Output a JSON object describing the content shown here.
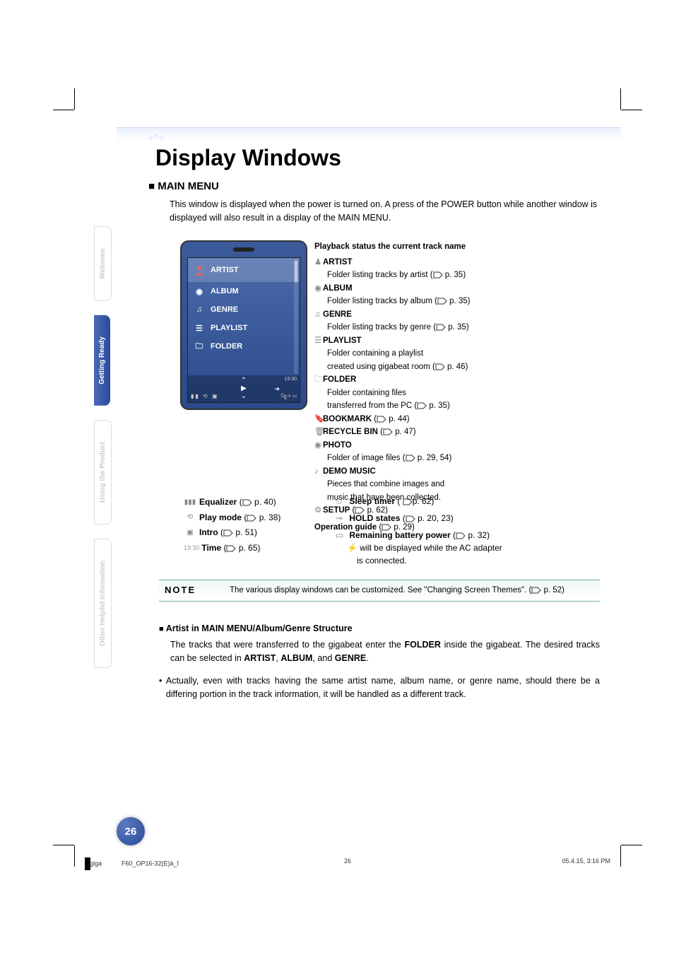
{
  "side_tabs": {
    "welcome": "Welcome",
    "ready": "Getting Ready",
    "using": "Using the Product",
    "other": "Other Helpful Information"
  },
  "title": "Display Windows",
  "section_heading": "MAIN MENU",
  "intro": "This window is displayed when the power is turned on. A press of the POWER button while another window is displayed will also result in a display of the MAIN MENU.",
  "device_menu": {
    "artist": "ARTIST",
    "artist_count": "5",
    "album": "ALBUM",
    "genre": "GENRE",
    "playlist": "PLAYLIST",
    "folder": "FOLDER",
    "time_small": "19:30"
  },
  "annotations": {
    "lead": "Playback status    the current track name",
    "artist_h": "ARTIST",
    "artist_d": "Folder listing tracks by artist (",
    "artist_p": "p. 35)",
    "album_h": "ALBUM",
    "album_d": "Folder listing tracks by album (",
    "album_p": "p. 35)",
    "genre_h": "GENRE",
    "genre_d": "Folder listing tracks by genre (",
    "genre_p": "p. 35)",
    "playlist_h": "PLAYLIST",
    "playlist_d1": "Folder containing a playlist",
    "playlist_d2": "created using gigabeat room (",
    "playlist_p": "p. 46)",
    "folder_h": "FOLDER",
    "folder_d1": "Folder containing files",
    "folder_d2": "transferred from the PC (",
    "folder_p": "p. 35)",
    "bookmark_h": "BOOKMARK",
    "bookmark_p": "p. 44)",
    "recycle_h": "RECYCLE BIN",
    "recycle_p": "p. 47)",
    "photo_h": "PHOTO",
    "photo_d": "Folder of image files (",
    "photo_p": "p. 29, 54)",
    "demo_h": "DEMO MUSIC",
    "demo_d1": "Pieces that combine images and",
    "demo_d2": "music that have been collected.",
    "setup_h": "SETUP",
    "setup_p": "p. 62)",
    "opguide": "Operation guide",
    "opguide_p": "p. 29)"
  },
  "lower_left": {
    "eq_label": "Equalizer",
    "eq_p": "p. 40)",
    "pm_label": "Play mode",
    "pm_p": "p. 38)",
    "intro_label": "Intro",
    "intro_p": "p. 51)",
    "time_label": "Time",
    "time_p": "p. 65)",
    "time_sample": "19:30"
  },
  "lower_right": {
    "sleep_label": "Sleep timer",
    "sleep_p": "p. 62)",
    "hold_label": "HOLD states",
    "hold_p": "p. 20, 23)",
    "batt_label": "Remaining battery power",
    "batt_p": "p. 32)",
    "batt_d1": "will be displayed while the AC adapter",
    "batt_d2": "is connected."
  },
  "note": {
    "label": "NOTE",
    "body1": "The various display windows can be customized. See \"Changing Screen Themes\". (",
    "body_p": "p. 52)"
  },
  "subsection": {
    "heading": "Artist in MAIN MENU/Album/Genre Structure",
    "p_lead": "The tracks that were transferred to the gigabeat enter the ",
    "p_folder": "FOLDER",
    "p_mid": " inside the gigabeat. The desired tracks can be selected in ",
    "p_artist": "ARTIST",
    "p_c1": ", ",
    "p_album": "ALBUM",
    "p_c2": ", and ",
    "p_genre": "GENRE",
    "p_end": ".",
    "bullet": "Actually, even with tracks having the same artist name, album name, or genre name, should there be a differing portion in the track information, it will be handled as a different track."
  },
  "page_number": "26",
  "footer": {
    "filename_left": "giga",
    "filename_right": "F60_OP16-32(E)à_î",
    "center": "26",
    "right": "05.4.15, 3:16 PM"
  }
}
